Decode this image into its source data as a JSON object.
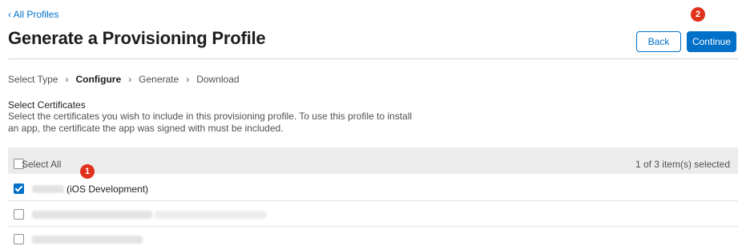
{
  "nav": {
    "back_link": "‹ All Profiles"
  },
  "header": {
    "title": "Generate a Provisioning Profile",
    "back_button": "Back",
    "continue_button": "Continue"
  },
  "steps": {
    "items": [
      {
        "label": "Select Type",
        "state": "done"
      },
      {
        "label": "Configure",
        "state": "current"
      },
      {
        "label": "Generate",
        "state": "upcoming"
      },
      {
        "label": "Download",
        "state": "upcoming"
      }
    ],
    "separator": "›"
  },
  "certificates": {
    "title": "Select Certificates",
    "description": "Select the certificates you wish to include in this provisioning profile. To use this profile to install an app, the certificate the app was signed with must be included.",
    "select_all_label": "Select All",
    "selected_count": "1 of 3 item(s) selected",
    "rows": [
      {
        "label": "(iOS Development)",
        "checked": true,
        "name_redacted": true
      },
      {
        "label": "",
        "checked": false,
        "name_redacted": true
      },
      {
        "label": "",
        "checked": false,
        "name_redacted": true
      }
    ]
  },
  "annotations": {
    "badge_1": "1",
    "badge_2": "2"
  },
  "colors": {
    "accent": "#0070c9",
    "badge": "#e0321c",
    "header_bg": "#ececec"
  }
}
